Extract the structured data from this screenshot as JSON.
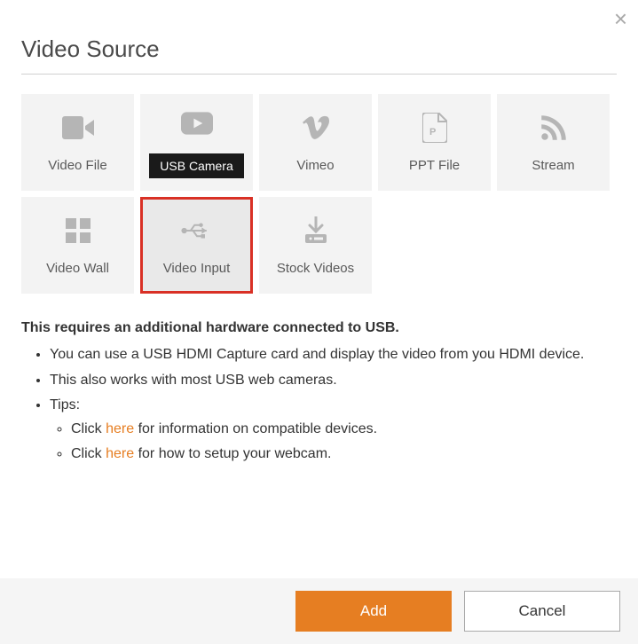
{
  "title": "Video Source",
  "tiles": [
    {
      "label": "Video File",
      "icon": "video-camera-icon",
      "badge": false,
      "selected": false
    },
    {
      "label": "USB Camera",
      "icon": "youtube-play-icon",
      "badge": true,
      "selected": false
    },
    {
      "label": "Vimeo",
      "icon": "vimeo-icon",
      "badge": false,
      "selected": false
    },
    {
      "label": "PPT File",
      "icon": "ppt-file-icon",
      "badge": false,
      "selected": false
    },
    {
      "label": "Stream",
      "icon": "rss-icon",
      "badge": false,
      "selected": false
    },
    {
      "label": "Video Wall",
      "icon": "grid-icon",
      "badge": false,
      "selected": false
    },
    {
      "label": "Video Input",
      "icon": "usb-icon",
      "badge": false,
      "selected": true
    },
    {
      "label": "Stock Videos",
      "icon": "download-icon",
      "badge": false,
      "selected": false
    }
  ],
  "description": {
    "heading": "This requires an additional hardware connected to USB.",
    "bullets": {
      "b0": "You can use a USB HDMI Capture card and display the video from you HDMI device.",
      "b1": "This also works with most USB web cameras.",
      "b2": "Tips:",
      "b2_sub0_pre": "Click ",
      "b2_sub0_link": "here",
      "b2_sub0_post": " for information on compatible devices.",
      "b2_sub1_pre": "Click ",
      "b2_sub1_link": "here",
      "b2_sub1_post": " for how to setup your webcam."
    }
  },
  "buttons": {
    "add": "Add",
    "cancel": "Cancel"
  }
}
